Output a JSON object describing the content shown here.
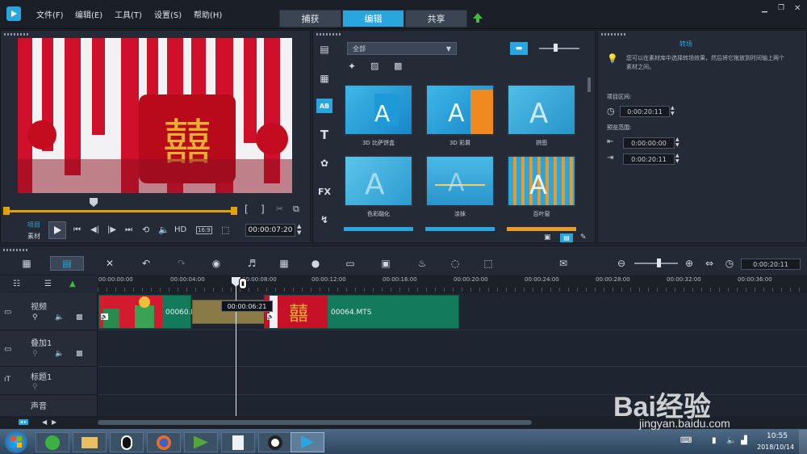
{
  "menu": {
    "file": "文件(F)",
    "edit": "编辑(E)",
    "tools": "工具(T)",
    "settings": "设置(S)",
    "help": "帮助(H)"
  },
  "tabs": {
    "capture": "捕获",
    "edit": "编辑",
    "share": "共享"
  },
  "window_controls": {
    "minimize": "▁",
    "restore": "❐",
    "close": "✕"
  },
  "preview": {
    "project_label": "项目",
    "clip_label": "素材",
    "hd_label": "HD",
    "ratio_label": "16:9",
    "timecode": "00:00:07:20"
  },
  "library": {
    "filter": "全部",
    "items": [
      {
        "label": "3D 比萨饼盒"
      },
      {
        "label": "3D 彩屑"
      },
      {
        "label": "拼图"
      },
      {
        "label": "色彩融化"
      },
      {
        "label": "涂抹"
      },
      {
        "label": "百叶窗"
      }
    ]
  },
  "options": {
    "title": "转场",
    "hint": "您可以在素材库中选择转场效果，然后将它拖放到时间轴上两个素材之间。",
    "duration_label": "项目区间:",
    "duration": "0:00:20:11",
    "preview_range_label": "预览范围:",
    "range_start": "0:00:00:00",
    "range_end": "0:00:20:11"
  },
  "timeline": {
    "zoom_timecode": "0:00:20:11",
    "ruler": [
      "00:00:00:00",
      "00:00:04:00",
      "00:00:08:00",
      "00:00:12:00",
      "00:00:16:00",
      "00:00:20:00",
      "00:00:24:00",
      "00:00:28:00",
      "00:00:32:00",
      "00:00:36:00"
    ],
    "playhead_tooltip": "00:00:06:21",
    "tracks": [
      {
        "name": "视频"
      },
      {
        "name": "叠加1"
      },
      {
        "name": "标题1"
      },
      {
        "name": "声音"
      }
    ],
    "clips": [
      {
        "name": "00060.M"
      },
      {
        "name": "00064.MTS"
      }
    ]
  },
  "taskbar": {
    "time": "10:55",
    "date": "2018/10/14"
  },
  "watermark": {
    "brand": "Bai经验",
    "url": "jingyan.baidu.com"
  },
  "colors": {
    "accent": "#2aa6de",
    "clip": "#137a5c",
    "transition": "#8a7a45"
  }
}
